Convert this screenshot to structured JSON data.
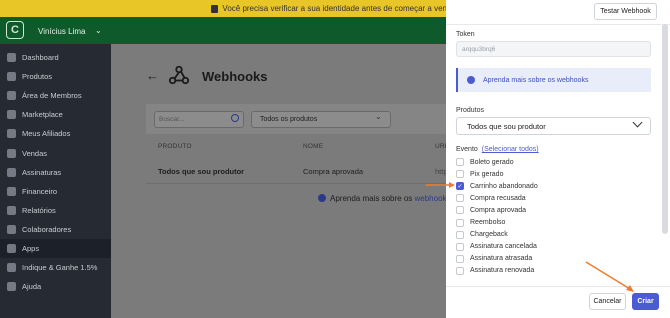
{
  "banner": {
    "text": "Você precisa verificar a sua identidade antes de começar a vender"
  },
  "user": {
    "name": "Vinícius Lima"
  },
  "sidebar": {
    "items": [
      {
        "label": "Dashboard",
        "icon": "home-icon"
      },
      {
        "label": "Produtos",
        "icon": "box-icon"
      },
      {
        "label": "Área de Membros",
        "icon": "graduation-icon"
      },
      {
        "label": "Marketplace",
        "icon": "store-icon"
      },
      {
        "label": "Meus Afiliados",
        "icon": "users-icon"
      },
      {
        "label": "Vendas",
        "icon": "chart-icon"
      },
      {
        "label": "Assinaturas",
        "icon": "repeat-icon"
      },
      {
        "label": "Financeiro",
        "icon": "wallet-icon"
      },
      {
        "label": "Relatórios",
        "icon": "report-icon"
      },
      {
        "label": "Colaboradores",
        "icon": "team-icon"
      },
      {
        "label": "Apps",
        "icon": "apps-icon"
      },
      {
        "label": "Indique & Ganhe 1.5%",
        "icon": "gift-icon"
      },
      {
        "label": "Ajuda",
        "icon": "help-icon"
      }
    ]
  },
  "main": {
    "title": "Webhooks",
    "search_placeholder": "Buscar...",
    "product_filter": "Todos os produtos",
    "columns": [
      "PRODUTO",
      "NOME",
      "URL"
    ],
    "row": {
      "produto": "Todos que sou produtor",
      "nome": "Compra aprovada",
      "url": "http"
    },
    "learn_text": "Aprenda mais sobre os",
    "learn_link": "webhooks"
  },
  "drawer": {
    "test_button": "Testar Webhook",
    "token_label": "Token",
    "token_value": "arqqu3brq6",
    "info_text": "Aprenda mais sobre os webhooks",
    "produtos_label": "Produtos",
    "produtos_value": "Todos que sou produtor",
    "evento_label": "Evento",
    "select_all": "(Selecionar todos)",
    "events": [
      {
        "label": "Boleto gerado",
        "checked": false
      },
      {
        "label": "Pix gerado",
        "checked": false
      },
      {
        "label": "Carrinho abandonado",
        "checked": true
      },
      {
        "label": "Compra recusada",
        "checked": false
      },
      {
        "label": "Compra aprovada",
        "checked": false
      },
      {
        "label": "Reembolso",
        "checked": false
      },
      {
        "label": "Chargeback",
        "checked": false
      },
      {
        "label": "Assinatura cancelada",
        "checked": false
      },
      {
        "label": "Assinatura atrasada",
        "checked": false
      },
      {
        "label": "Assinatura renovada",
        "checked": false
      }
    ],
    "cancel_button": "Cancelar",
    "create_button": "Criar"
  },
  "colors": {
    "topbar": "#0e5a2a",
    "banner": "#e9c628",
    "accent": "#4b5bd1",
    "annotation": "#f07c2a"
  }
}
